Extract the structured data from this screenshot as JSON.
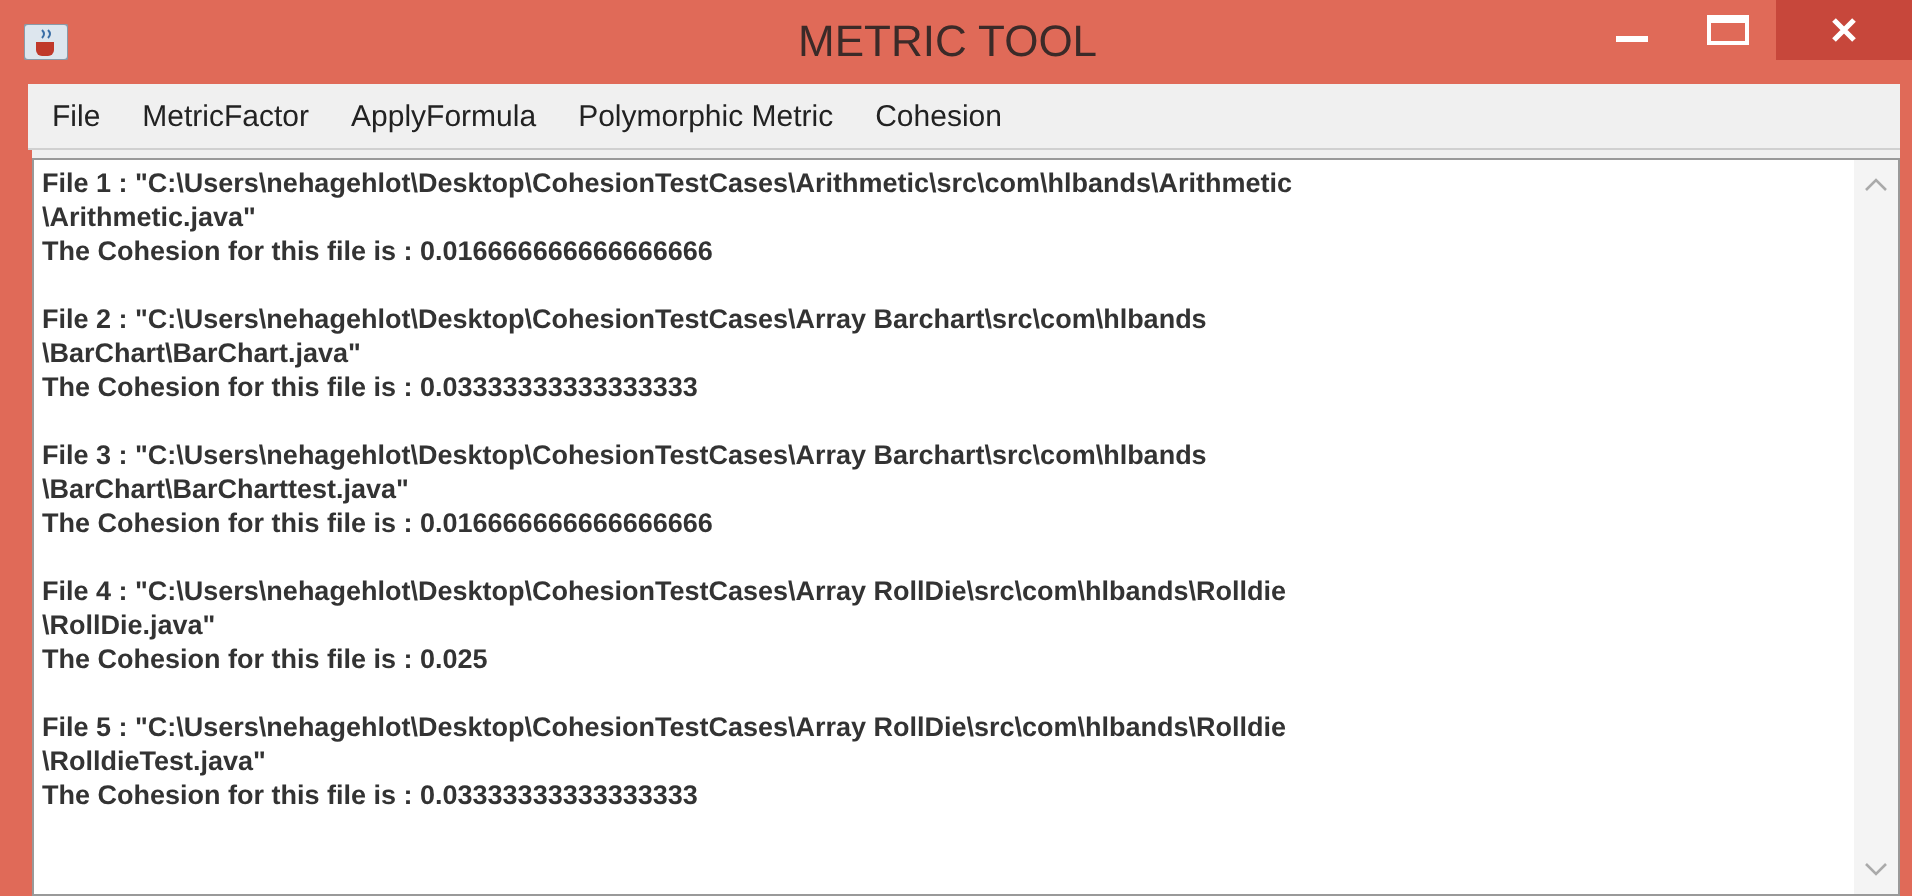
{
  "window": {
    "title": "METRIC TOOL"
  },
  "menu": [
    "File",
    "MetricFactor",
    "ApplyFormula",
    "Polymorphic Metric",
    "Cohesion"
  ],
  "entries": [
    {
      "path_lines": [
        "File 1 : \"C:\\Users\\nehagehlot\\Desktop\\CohesionTestCases\\Arithmetic\\src\\com\\hlbands\\Arithmetic",
        "\\Arithmetic.java\""
      ],
      "result": "The Cohesion for this file is : 0.016666666666666666"
    },
    {
      "path_lines": [
        "File 2 : \"C:\\Users\\nehagehlot\\Desktop\\CohesionTestCases\\Array Barchart\\src\\com\\hlbands",
        "\\BarChart\\BarChart.java\""
      ],
      "result": "The Cohesion for this file is : 0.03333333333333333"
    },
    {
      "path_lines": [
        "File 3 : \"C:\\Users\\nehagehlot\\Desktop\\CohesionTestCases\\Array Barchart\\src\\com\\hlbands",
        "\\BarChart\\BarCharttest.java\""
      ],
      "result": "The Cohesion for this file is : 0.016666666666666666"
    },
    {
      "path_lines": [
        "File 4 : \"C:\\Users\\nehagehlot\\Desktop\\CohesionTestCases\\Array RollDie\\src\\com\\hlbands\\Rolldie",
        "\\RollDie.java\""
      ],
      "result": "The Cohesion for this file is : 0.025"
    },
    {
      "path_lines": [
        "File 5 : \"C:\\Users\\nehagehlot\\Desktop\\CohesionTestCases\\Array RollDie\\src\\com\\hlbands\\Rolldie",
        "\\RolldieTest.java\""
      ],
      "result": "The Cohesion for this file is : 0.03333333333333333"
    }
  ]
}
